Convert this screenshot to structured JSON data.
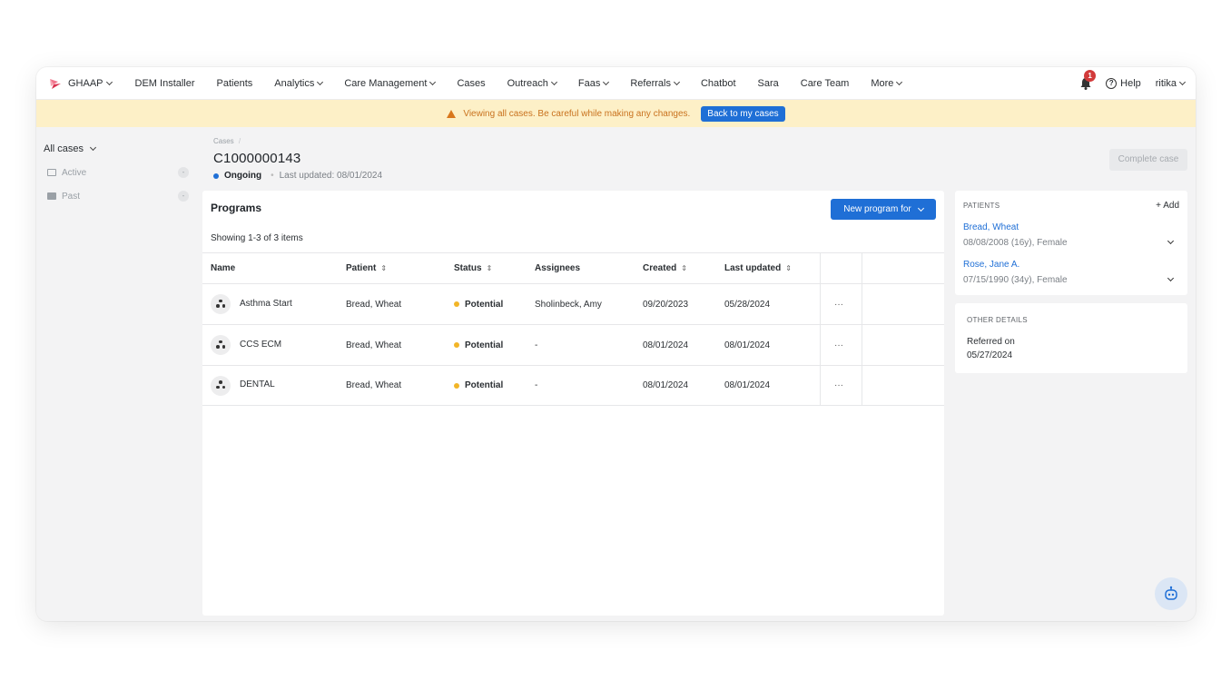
{
  "nav": {
    "brand": "GHAAP",
    "items": [
      {
        "label": "DEM Installer",
        "dropdown": false
      },
      {
        "label": "Patients",
        "dropdown": false
      },
      {
        "label": "Analytics",
        "dropdown": true
      },
      {
        "label": "Care Management",
        "dropdown": true
      },
      {
        "label": "Cases",
        "dropdown": false
      },
      {
        "label": "Outreach",
        "dropdown": true
      },
      {
        "label": "Faas",
        "dropdown": true
      },
      {
        "label": "Referrals",
        "dropdown": true
      },
      {
        "label": "Chatbot",
        "dropdown": false
      },
      {
        "label": "Sara",
        "dropdown": false
      },
      {
        "label": "Care Team",
        "dropdown": false
      },
      {
        "label": "More",
        "dropdown": true
      }
    ],
    "notification_count": "1",
    "help_label": "Help",
    "user_label": "ritika"
  },
  "banner": {
    "message": "Viewing all cases. Be careful while making any changes.",
    "button_label": "Back to my cases"
  },
  "sidebar": {
    "header": "All cases",
    "items": [
      {
        "label": "Active",
        "count": "-"
      },
      {
        "label": "Past",
        "count": "-"
      }
    ]
  },
  "case": {
    "breadcrumb": "Cases",
    "breadcrumb_sep": "/",
    "id": "C1000000143",
    "status": "Ongoing",
    "last_updated": "Last updated: 08/01/2024",
    "complete_label": "Complete case"
  },
  "programs": {
    "title": "Programs",
    "new_button": "New program for",
    "showing": "Showing 1-3 of 3 items",
    "columns": [
      "Name",
      "Patient",
      "Status",
      "Assignees",
      "Created",
      "Last updated"
    ],
    "rows": [
      {
        "name": "Asthma Start",
        "patient": "Bread, Wheat",
        "status": "Potential",
        "assignees": "Sholinbeck, Amy",
        "created": "09/20/2023",
        "updated": "05/28/2024",
        "actions": "···"
      },
      {
        "name": "CCS ECM",
        "patient": "Bread, Wheat",
        "status": "Potential",
        "assignees": "-",
        "created": "08/01/2024",
        "updated": "08/01/2024",
        "actions": "···"
      },
      {
        "name": "DENTAL",
        "patient": "Bread, Wheat",
        "status": "Potential",
        "assignees": "-",
        "created": "08/01/2024",
        "updated": "08/01/2024",
        "actions": "···"
      }
    ]
  },
  "patients_card": {
    "title": "PATIENTS",
    "add_label": "+ Add",
    "patients": [
      {
        "name": "Bread, Wheat",
        "meta": "08/08/2008 (16y), Female"
      },
      {
        "name": "Rose, Jane A.",
        "meta": "07/15/1990 (34y), Female"
      }
    ]
  },
  "other_details": {
    "title": "OTHER DETAILS",
    "key": "Referred on",
    "value": "05/27/2024"
  },
  "colors": {
    "primary": "#1f6fd6",
    "banner_bg": "#fdf0c7",
    "warning": "#d9771c",
    "status_ongoing": "#1f6fd6",
    "status_potential": "#f2b527",
    "badge": "#d23a3a"
  }
}
